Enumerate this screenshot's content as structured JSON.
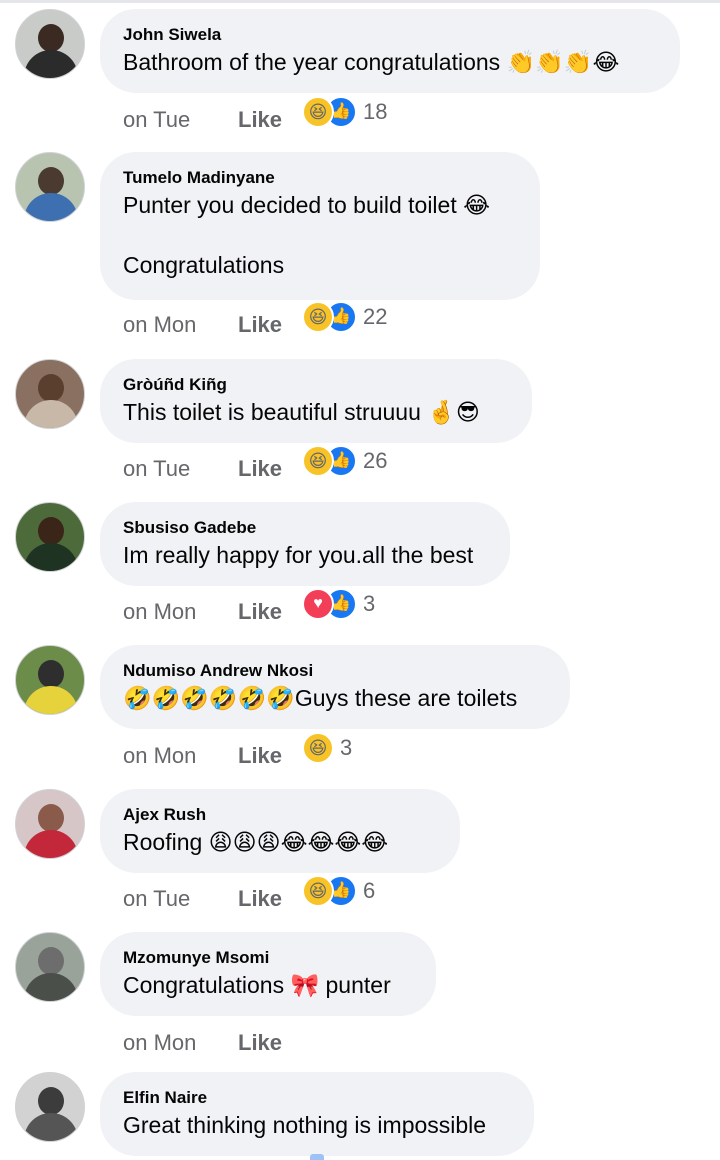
{
  "like_label": "Like",
  "colors": {
    "bubble": "#f0f2f5",
    "meta_text": "#65676b",
    "like_reaction": "#1877f2",
    "haha_reaction": "#f7c327",
    "love_reaction": "#f33e58"
  },
  "comments": [
    {
      "name": "John Siwela",
      "text": "Bathroom of the year congratulations 👏👏👏😂",
      "time": "on Tue",
      "reactions": [
        "haha-icon",
        "like-icon"
      ],
      "reaction_count": "18"
    },
    {
      "name": "Tumelo Madinyane",
      "text": "Punter you decided to build toilet 😂\n\nCongratulations",
      "time": "on Mon",
      "reactions": [
        "haha-icon",
        "like-icon"
      ],
      "reaction_count": "22"
    },
    {
      "name": "Gròúñd Kiñg",
      "text": "This toilet is beautiful struuuu 🤞😎",
      "time": "on Tue",
      "reactions": [
        "haha-icon",
        "like-icon"
      ],
      "reaction_count": "26"
    },
    {
      "name": "Sbusiso Gadebe",
      "text": "Im really happy for you.all the best",
      "time": "on Mon",
      "reactions": [
        "love-icon",
        "like-icon"
      ],
      "reaction_count": "3"
    },
    {
      "name": "Ndumiso Andrew Nkosi",
      "text": "🤣🤣🤣🤣🤣🤣Guys these are toilets",
      "time": "on Mon",
      "reactions": [
        "haha-icon"
      ],
      "reaction_count": "3"
    },
    {
      "name": "Ajex Rush",
      "text": "Roofing 😩😩😩😂😂😂😂",
      "time": "on Tue",
      "reactions": [
        "haha-icon",
        "like-icon"
      ],
      "reaction_count": "6"
    },
    {
      "name": "Mzomunye Msomi",
      "text": "Congratulations 🎀 punter",
      "time": "on Mon",
      "reactions": [],
      "reaction_count": ""
    },
    {
      "name": "Elfin Naire",
      "text": "Great thinking nothing is impossible",
      "time": "",
      "reactions": [],
      "reaction_count": ""
    }
  ]
}
